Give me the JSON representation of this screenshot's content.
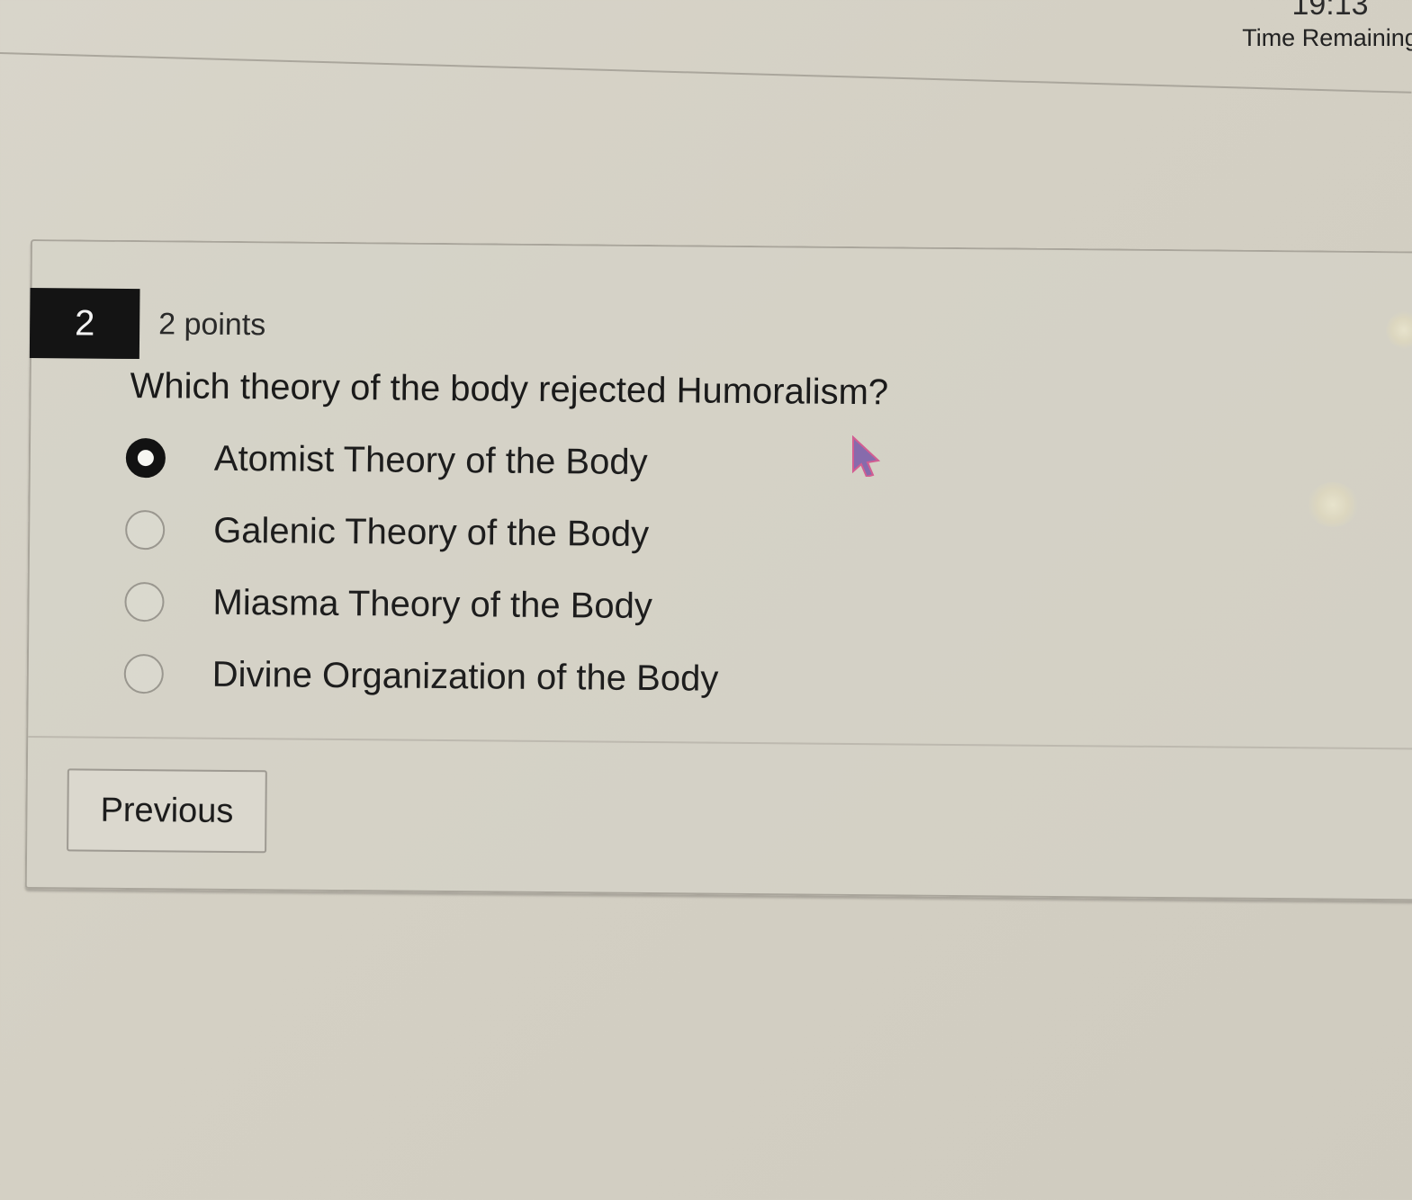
{
  "timer": {
    "value": "19:13",
    "label": "Time Remaining"
  },
  "question": {
    "number": "2",
    "points": "2 points",
    "text": "Which theory of the body rejected Humoralism?",
    "options": [
      {
        "label": "Atomist Theory of the Body",
        "selected": true
      },
      {
        "label": "Galenic Theory of the Body",
        "selected": false
      },
      {
        "label": "Miasma Theory of the Body",
        "selected": false
      },
      {
        "label": "Divine Organization of the Body",
        "selected": false
      }
    ]
  },
  "navigation": {
    "previous_label": "Previous"
  },
  "icons": {
    "pointer": "mouse-pointer-icon"
  }
}
